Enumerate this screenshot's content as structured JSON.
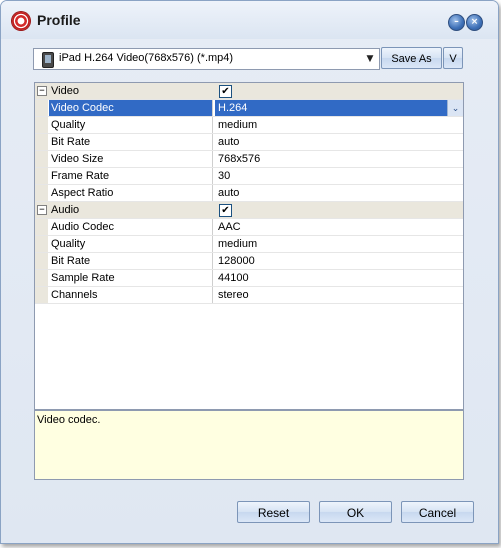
{
  "window": {
    "title": "Profile",
    "minimize_glyph": "–",
    "close_glyph": "×"
  },
  "profile": {
    "selected": "iPad H.264 Video(768x576) (*.mp4)",
    "save_as_label": "Save As",
    "v_label": "V"
  },
  "grid": {
    "categories": [
      {
        "name": "Video",
        "enabled": true,
        "expander": "−",
        "check": "✔",
        "rows": [
          {
            "name": "Video Codec",
            "value": "H.264",
            "selected": true
          },
          {
            "name": "Quality",
            "value": "medium"
          },
          {
            "name": "Bit Rate",
            "value": "auto"
          },
          {
            "name": "Video Size",
            "value": "768x576"
          },
          {
            "name": "Frame Rate",
            "value": "30"
          },
          {
            "name": "Aspect Ratio",
            "value": "auto"
          }
        ]
      },
      {
        "name": "Audio",
        "enabled": true,
        "expander": "−",
        "check": "✔",
        "rows": [
          {
            "name": "Audio Codec",
            "value": "AAC"
          },
          {
            "name": "Quality",
            "value": "medium"
          },
          {
            "name": "Bit Rate",
            "value": "128000"
          },
          {
            "name": "Sample Rate",
            "value": "44100"
          },
          {
            "name": "Channels",
            "value": "stereo"
          }
        ]
      }
    ]
  },
  "description": "Video codec.",
  "footer": {
    "reset_label": "Reset",
    "ok_label": "OK",
    "cancel_label": "Cancel"
  },
  "colors": {
    "selection": "#316ac5",
    "category_band": "#eae7dd",
    "description_bg": "#ffffe1"
  }
}
